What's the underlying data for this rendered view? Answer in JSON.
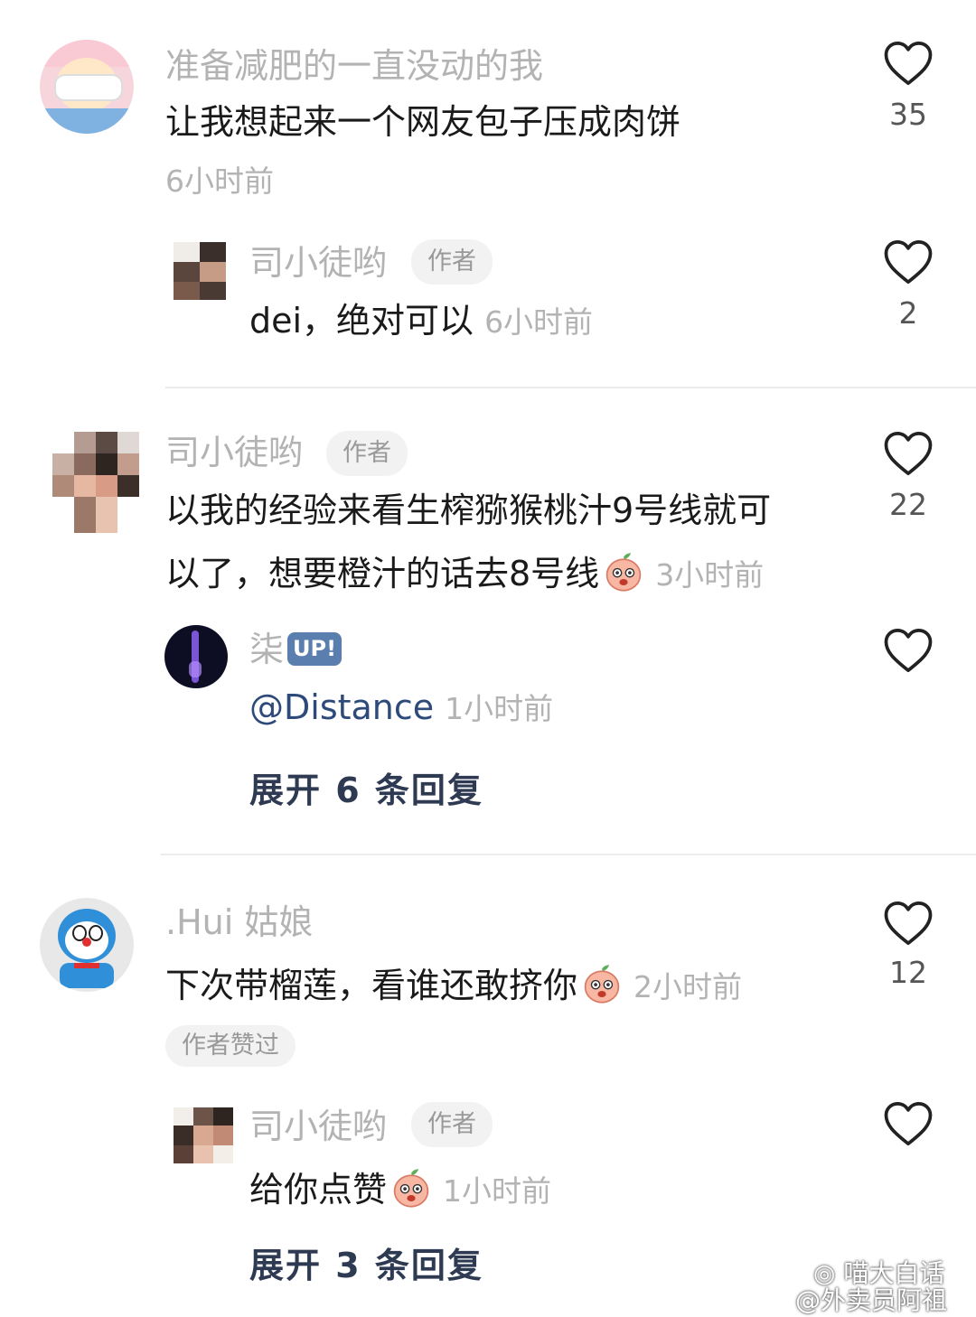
{
  "comments": [
    {
      "username": "准备减肥的一直没动的我",
      "text": "让我想起来一个网友包子压成肉饼",
      "time": "6小时前",
      "likes": "35",
      "replies": [
        {
          "username": "司小徒哟",
          "badge": "作者",
          "text": "dei，绝对可以",
          "time": "6小时前",
          "likes": "2"
        }
      ]
    },
    {
      "username": "司小徒哟",
      "badge": "作者",
      "text_line1": "以我的经验来看生榨猕猴桃汁9号线就可",
      "text_line2": "以了，想要橙汁的话去8号线",
      "time": "3小时前",
      "likes": "22",
      "replies": [
        {
          "username": "柒",
          "badge": "UP!",
          "text": "@Distance",
          "time": "1小时前",
          "likes": ""
        }
      ],
      "expand": "展开 6 条回复"
    },
    {
      "username": ".Hui 姑娘",
      "text": "下次带榴莲，看谁还敢挤你",
      "time": "2小时前",
      "likes": "12",
      "author_liked": "作者赞过",
      "replies": [
        {
          "username": "司小徒哟",
          "badge": "作者",
          "text": "给你点赞",
          "time": "1小时前",
          "likes": ""
        }
      ],
      "expand": "展开 3 条回复"
    }
  ],
  "icons": {
    "like": "heart-outline-icon",
    "emoji": "peach-emoji-icon"
  },
  "watermark": {
    "line1": "喵大白话",
    "line2": "@外卖员阿祖"
  },
  "colors": {
    "username": "#b3b3b3",
    "expand": "#2d3a52",
    "up_badge": "#5a7fae"
  }
}
